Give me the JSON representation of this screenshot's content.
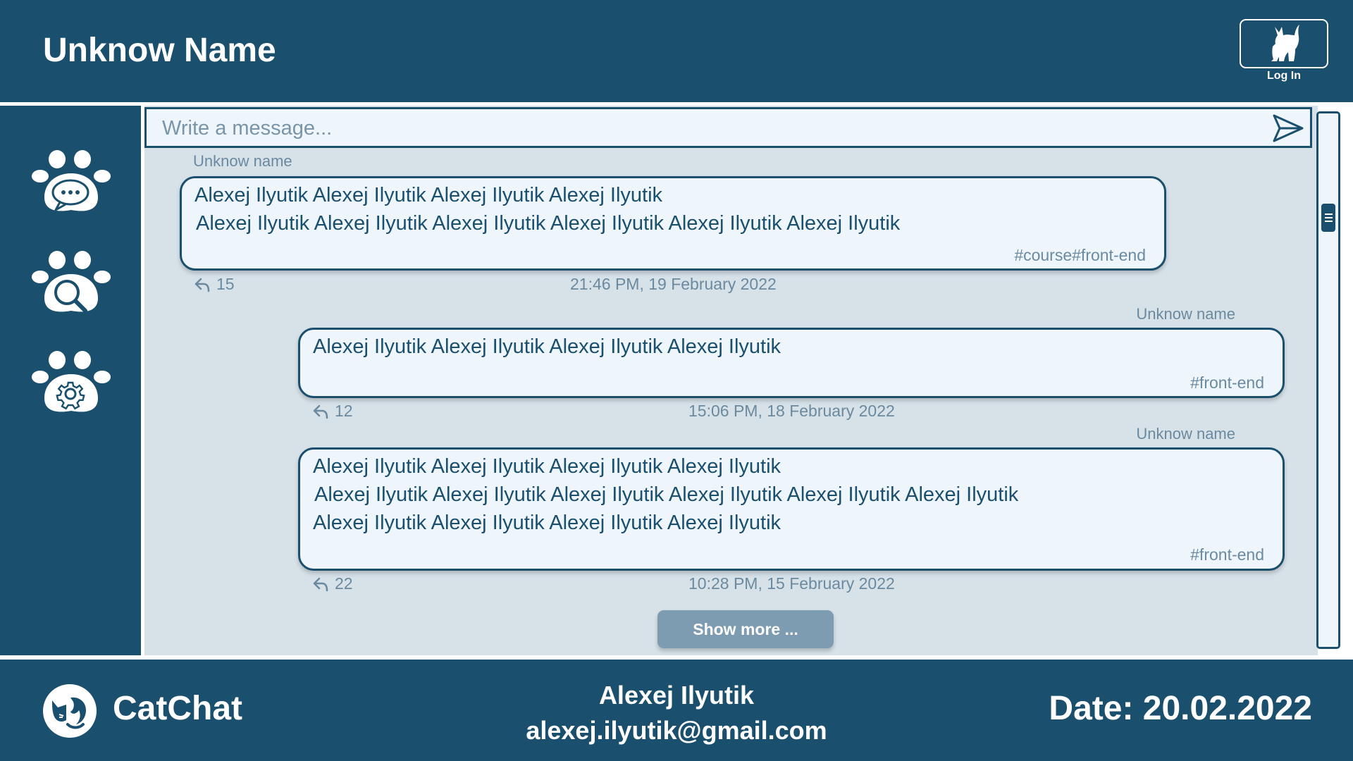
{
  "header": {
    "title": "Unknow Name",
    "login_label": "Log In"
  },
  "sidebar": {
    "items": [
      {
        "name": "chats",
        "icon": "paw-chat-icon"
      },
      {
        "name": "search",
        "icon": "paw-search-icon"
      },
      {
        "name": "settings",
        "icon": "paw-settings-icon"
      }
    ]
  },
  "composer": {
    "placeholder": "Write a message...",
    "value": ""
  },
  "messages": [
    {
      "author": "Unknow name",
      "lines": [
        "Alexej Ilyutik Alexej Ilyutik Alexej Ilyutik Alexej Ilyutik",
        "Alexej Ilyutik Alexej Ilyutik Alexej Ilyutik Alexej Ilyutik Alexej Ilyutik Alexej Ilyutik"
      ],
      "tags": "#course#front-end",
      "replies": "15",
      "time": "21:46 PM, 19 February 2022"
    },
    {
      "author": "Unknow name",
      "lines": [
        "Alexej Ilyutik Alexej Ilyutik Alexej Ilyutik Alexej Ilyutik"
      ],
      "tags": "#front-end",
      "replies": "12",
      "time": "15:06 PM, 18 February 2022"
    },
    {
      "author": "Unknow name",
      "lines": [
        "Alexej Ilyutik Alexej Ilyutik Alexej Ilyutik Alexej Ilyutik",
        "Alexej Ilyutik Alexej Ilyutik Alexej Ilyutik Alexej Ilyutik Alexej Ilyutik Alexej Ilyutik",
        "Alexej Ilyutik Alexej Ilyutik Alexej Ilyutik Alexej Ilyutik"
      ],
      "tags": "#front-end",
      "replies": "22",
      "time": "10:28 PM, 15 February 2022"
    }
  ],
  "show_more_label": "Show more ...",
  "footer": {
    "brand": "CatChat",
    "author_name": "Alexej Ilyutik",
    "author_email": "alexej.ilyutik@gmail.com",
    "date": "Date: 20.02.2022"
  },
  "colors": {
    "primary": "#1b4f6e",
    "panel": "#d6e1e8",
    "bubble": "#eef6fb",
    "muted": "#6b8aa0",
    "button": "#7d9bb1"
  }
}
